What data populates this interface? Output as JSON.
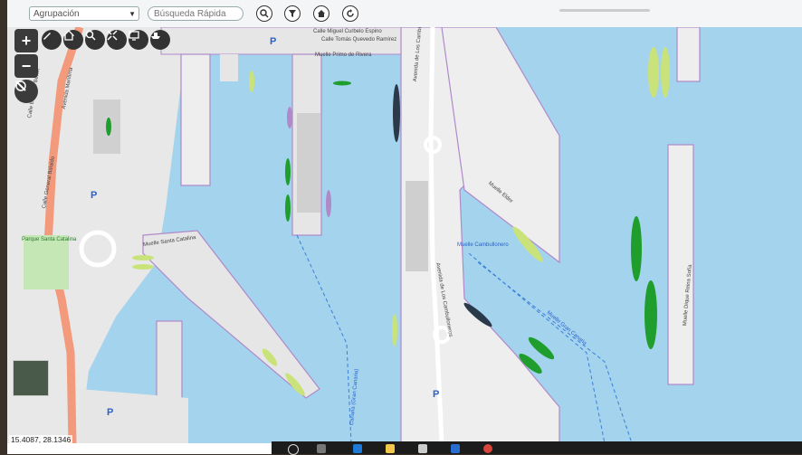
{
  "toolbar": {
    "group_select_value": "Agrupación",
    "search_placeholder": "Búsqueda Rápida",
    "buttons": [
      "search-icon",
      "filter-icon",
      "home-icon",
      "refresh-icon"
    ]
  },
  "map_controls": {
    "zoom_in": "+",
    "zoom_out": "−"
  },
  "map_tools": [
    "pencil-icon",
    "house-icon",
    "zoom-search-icon",
    "extent-icon",
    "monitor-icon",
    "ship-icon"
  ],
  "map_labels": {
    "calle_miguel": "Calle Miguel Curbelo Espino",
    "calle_tomas": "Calle Tomás Quevedo Ramírez",
    "muelle_primo": "Muelle Primo de Rivera",
    "avenida_cambulloneros_top": "Avenida de Los Cambulloneros",
    "avenida_cambulloneros_bottom": "Avenida de Los Cambulloneros",
    "avenida_maritima": "Avenida Marítima",
    "calle_eduardo": "Calle Eduardo Benot",
    "calle_general": "Calle General Balaldo",
    "muelle_santa_catalina": "Muelle Santa Catalina",
    "parque_santa_catalina": "Parque Santa Catalina",
    "muelle_elder": "Muelle Elder",
    "muelle_cambullonero": "Muelle Cambullonero",
    "muelle_gran_canaria": "Muelle Gran Canaria",
    "canaria_gran_canaria": "Canaria (Gran Canaria)",
    "muelle_reina_sofia": "Muelle Dique Reina Sofía"
  },
  "parking_symbol": "P",
  "coordinates": "15.4087, 28.1346",
  "colors": {
    "water": "#a4d3ee",
    "land": "#eeeeee",
    "pier_border": "#b089c9",
    "vessel_green": "#1f9e2e",
    "vessel_lime": "#c9e37a",
    "vessel_dark": "#2b3a4a",
    "road_orange": "#f29a7b"
  },
  "taskbar_icons": [
    "search-icon",
    "task-view-icon",
    "edge-icon",
    "folder-icon",
    "store-icon",
    "mail-icon",
    "chrome-icon"
  ]
}
